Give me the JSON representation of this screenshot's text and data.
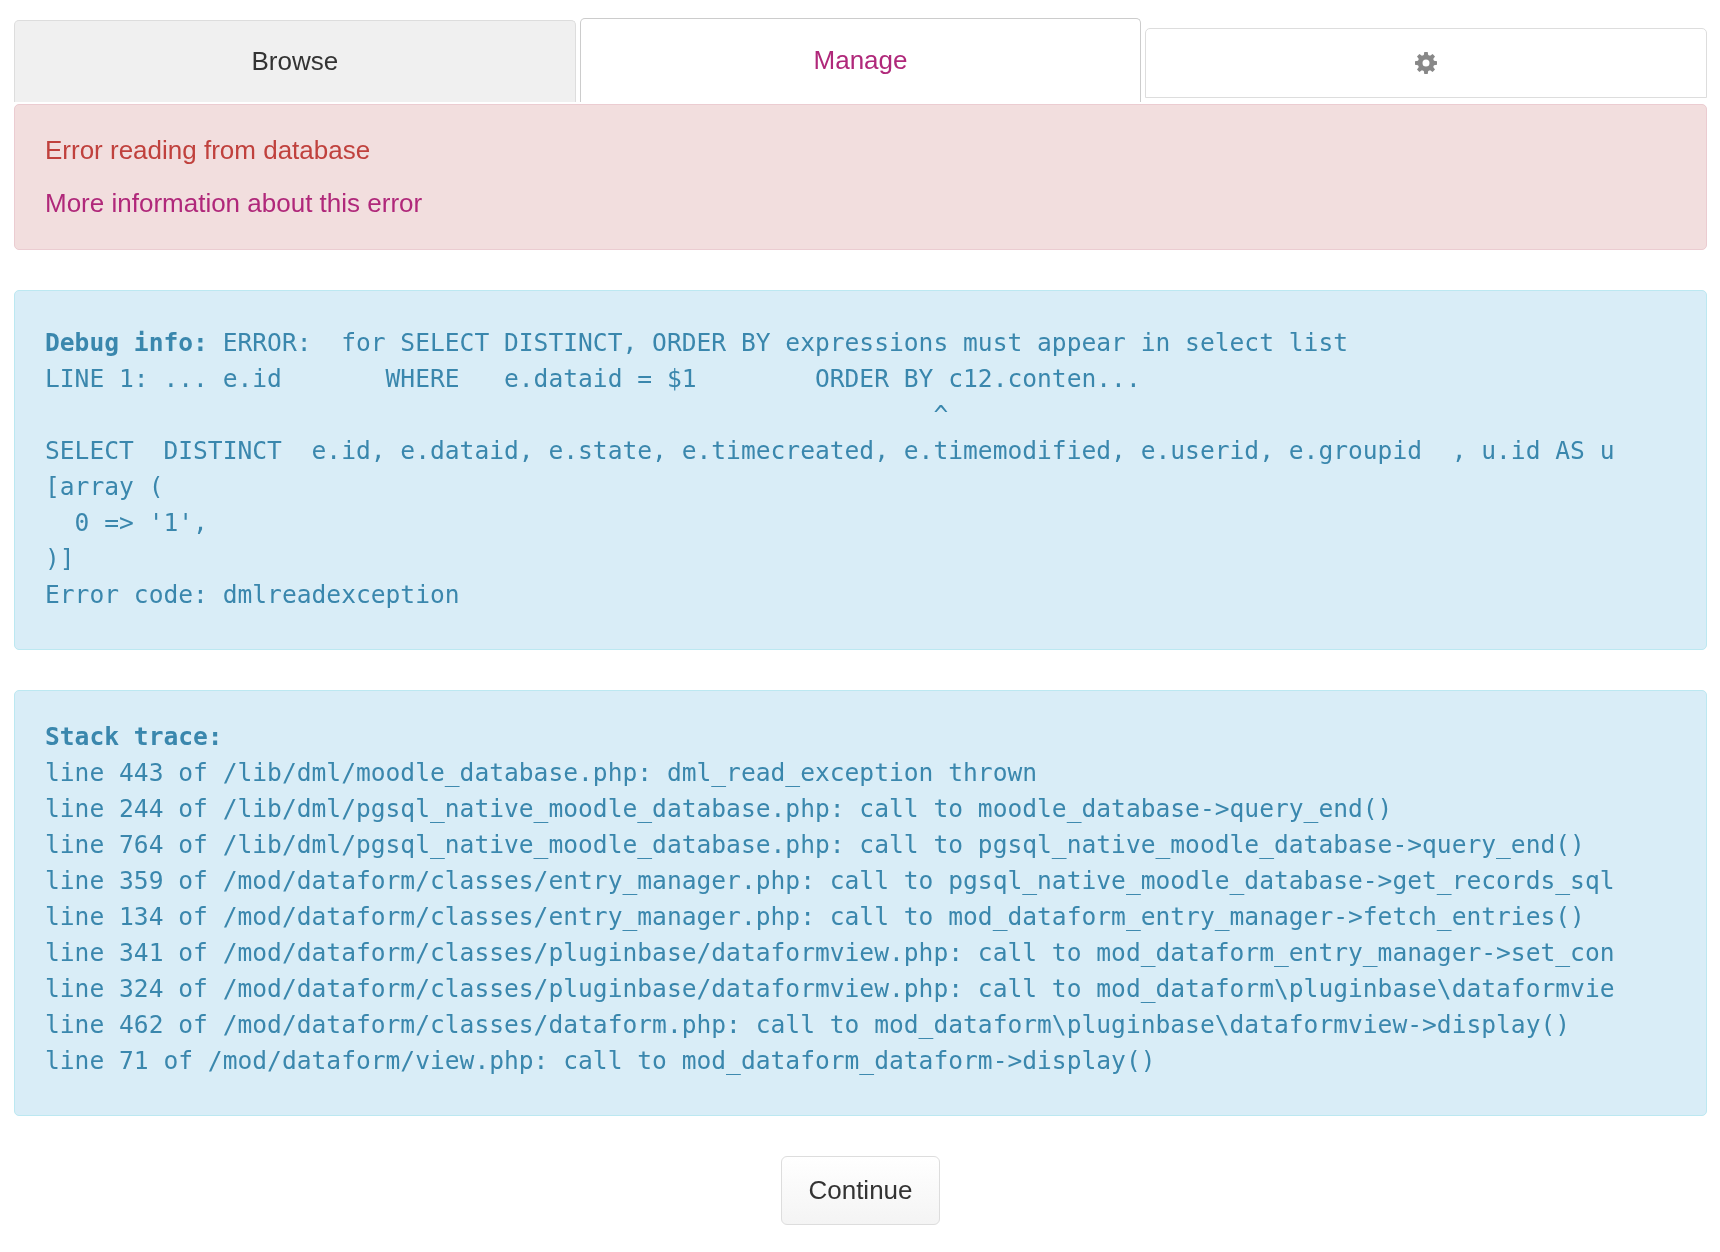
{
  "tabs": [
    {
      "kind": "text",
      "label": "Browse",
      "selected": false
    },
    {
      "kind": "text",
      "label": "Manage",
      "selected": true
    },
    {
      "kind": "icon",
      "selected": false
    }
  ],
  "alert": {
    "message": "Error reading from database",
    "link": "More information about this error"
  },
  "debug_info": {
    "lines": [
      "**Debug info:** ERROR:  for SELECT DISTINCT, ORDER BY expressions must appear in select list",
      "LINE 1: ... e.id       WHERE   e.dataid = $1        ORDER BY c12.conten...",
      "                                                            ^",
      "SELECT  DISTINCT  e.id, e.dataid, e.state, e.timecreated, e.timemodified, e.userid, e.groupid  , u.id AS u",
      "[array (",
      "  0 => '1',",
      ")]",
      "Error code: dmlreadexception"
    ]
  },
  "stack_trace": {
    "title": "Stack trace:",
    "lines": [
      "line 443 of /lib/dml/moodle_database.php: dml_read_exception thrown",
      "line 244 of /lib/dml/pgsql_native_moodle_database.php: call to moodle_database->query_end()",
      "line 764 of /lib/dml/pgsql_native_moodle_database.php: call to pgsql_native_moodle_database->query_end()",
      "line 359 of /mod/dataform/classes/entry_manager.php: call to pgsql_native_moodle_database->get_records_sql",
      "line 134 of /mod/dataform/classes/entry_manager.php: call to mod_dataform_entry_manager->fetch_entries()",
      "line 341 of /mod/dataform/classes/pluginbase/dataformview.php: call to mod_dataform_entry_manager->set_con",
      "line 324 of /mod/dataform/classes/pluginbase/dataformview.php: call to mod_dataform\\pluginbase\\dataformvie",
      "line 462 of /mod/dataform/classes/dataform.php: call to mod_dataform\\pluginbase\\dataformview->display()",
      "line 71 of /mod/dataform/view.php: call to mod_dataform_dataform->display()"
    ]
  },
  "continue_button": "Continue"
}
